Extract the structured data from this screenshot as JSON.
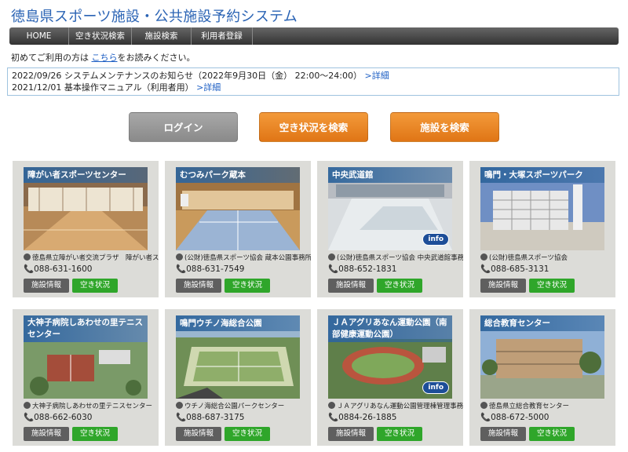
{
  "site_title": "徳島県スポーツ施設・公共施設予約システム",
  "nav": [
    "HOME",
    "空き状況検索",
    "施設検索",
    "利用者登録"
  ],
  "intro": {
    "before": "初めてご利用の方は ",
    "link": "こちら",
    "after": "をお読みください。"
  },
  "notices": [
    {
      "text": "2022/09/26 システムメンテナンスのお知らせ（2022年9月30日（金） 22:00〜24:00）",
      "more": ">詳細"
    },
    {
      "text": "2021/12/01 基本操作マニュアル（利用者用）",
      "more": ">詳細"
    }
  ],
  "buttons": {
    "login": "ログイン",
    "vacancy": "空き状況を検索",
    "facility": "施設を検索"
  },
  "card_buttons": {
    "info": "施設情報",
    "vacancy": "空き状況"
  },
  "info_badge": "info",
  "cards": [
    {
      "name": "障がい者スポーツセンター",
      "org": "徳島県立障がい者交流プラザ　障がい者スポ",
      "tel": "088-631-1600"
    },
    {
      "name": "むつみパーク蔵本",
      "org": "(公財)徳島県スポーツ協会 蔵本公園事務所",
      "tel": "088-631-7549"
    },
    {
      "name": "中央武道館",
      "org": "(公財)徳島県スポーツ協会 中央武道館事務所",
      "tel": "088-652-1831"
    },
    {
      "name": "鳴門・大塚スポーツパーク",
      "org": "(公財)徳島県スポーツ協会",
      "tel": "088-685-3131"
    },
    {
      "name": "大神子病院しあわせの里テニスセンター",
      "org": "大神子病院しあわせの里テニスセンター",
      "tel": "088-662-6030"
    },
    {
      "name": "鳴門ウチノ海総合公園",
      "org": "ウチノ海総合公園パークセンター",
      "tel": "088-687-3175"
    },
    {
      "name": "ＪＡアグリあなん運動公園（南部健康運動公園）",
      "org": "ＪＡアグリあなん運動公園管理棟管理事務所",
      "tel": "0884-26-1885"
    },
    {
      "name": "総合教育センター",
      "org": "徳島県立総合教育センター",
      "tel": "088-672-5000"
    }
  ]
}
